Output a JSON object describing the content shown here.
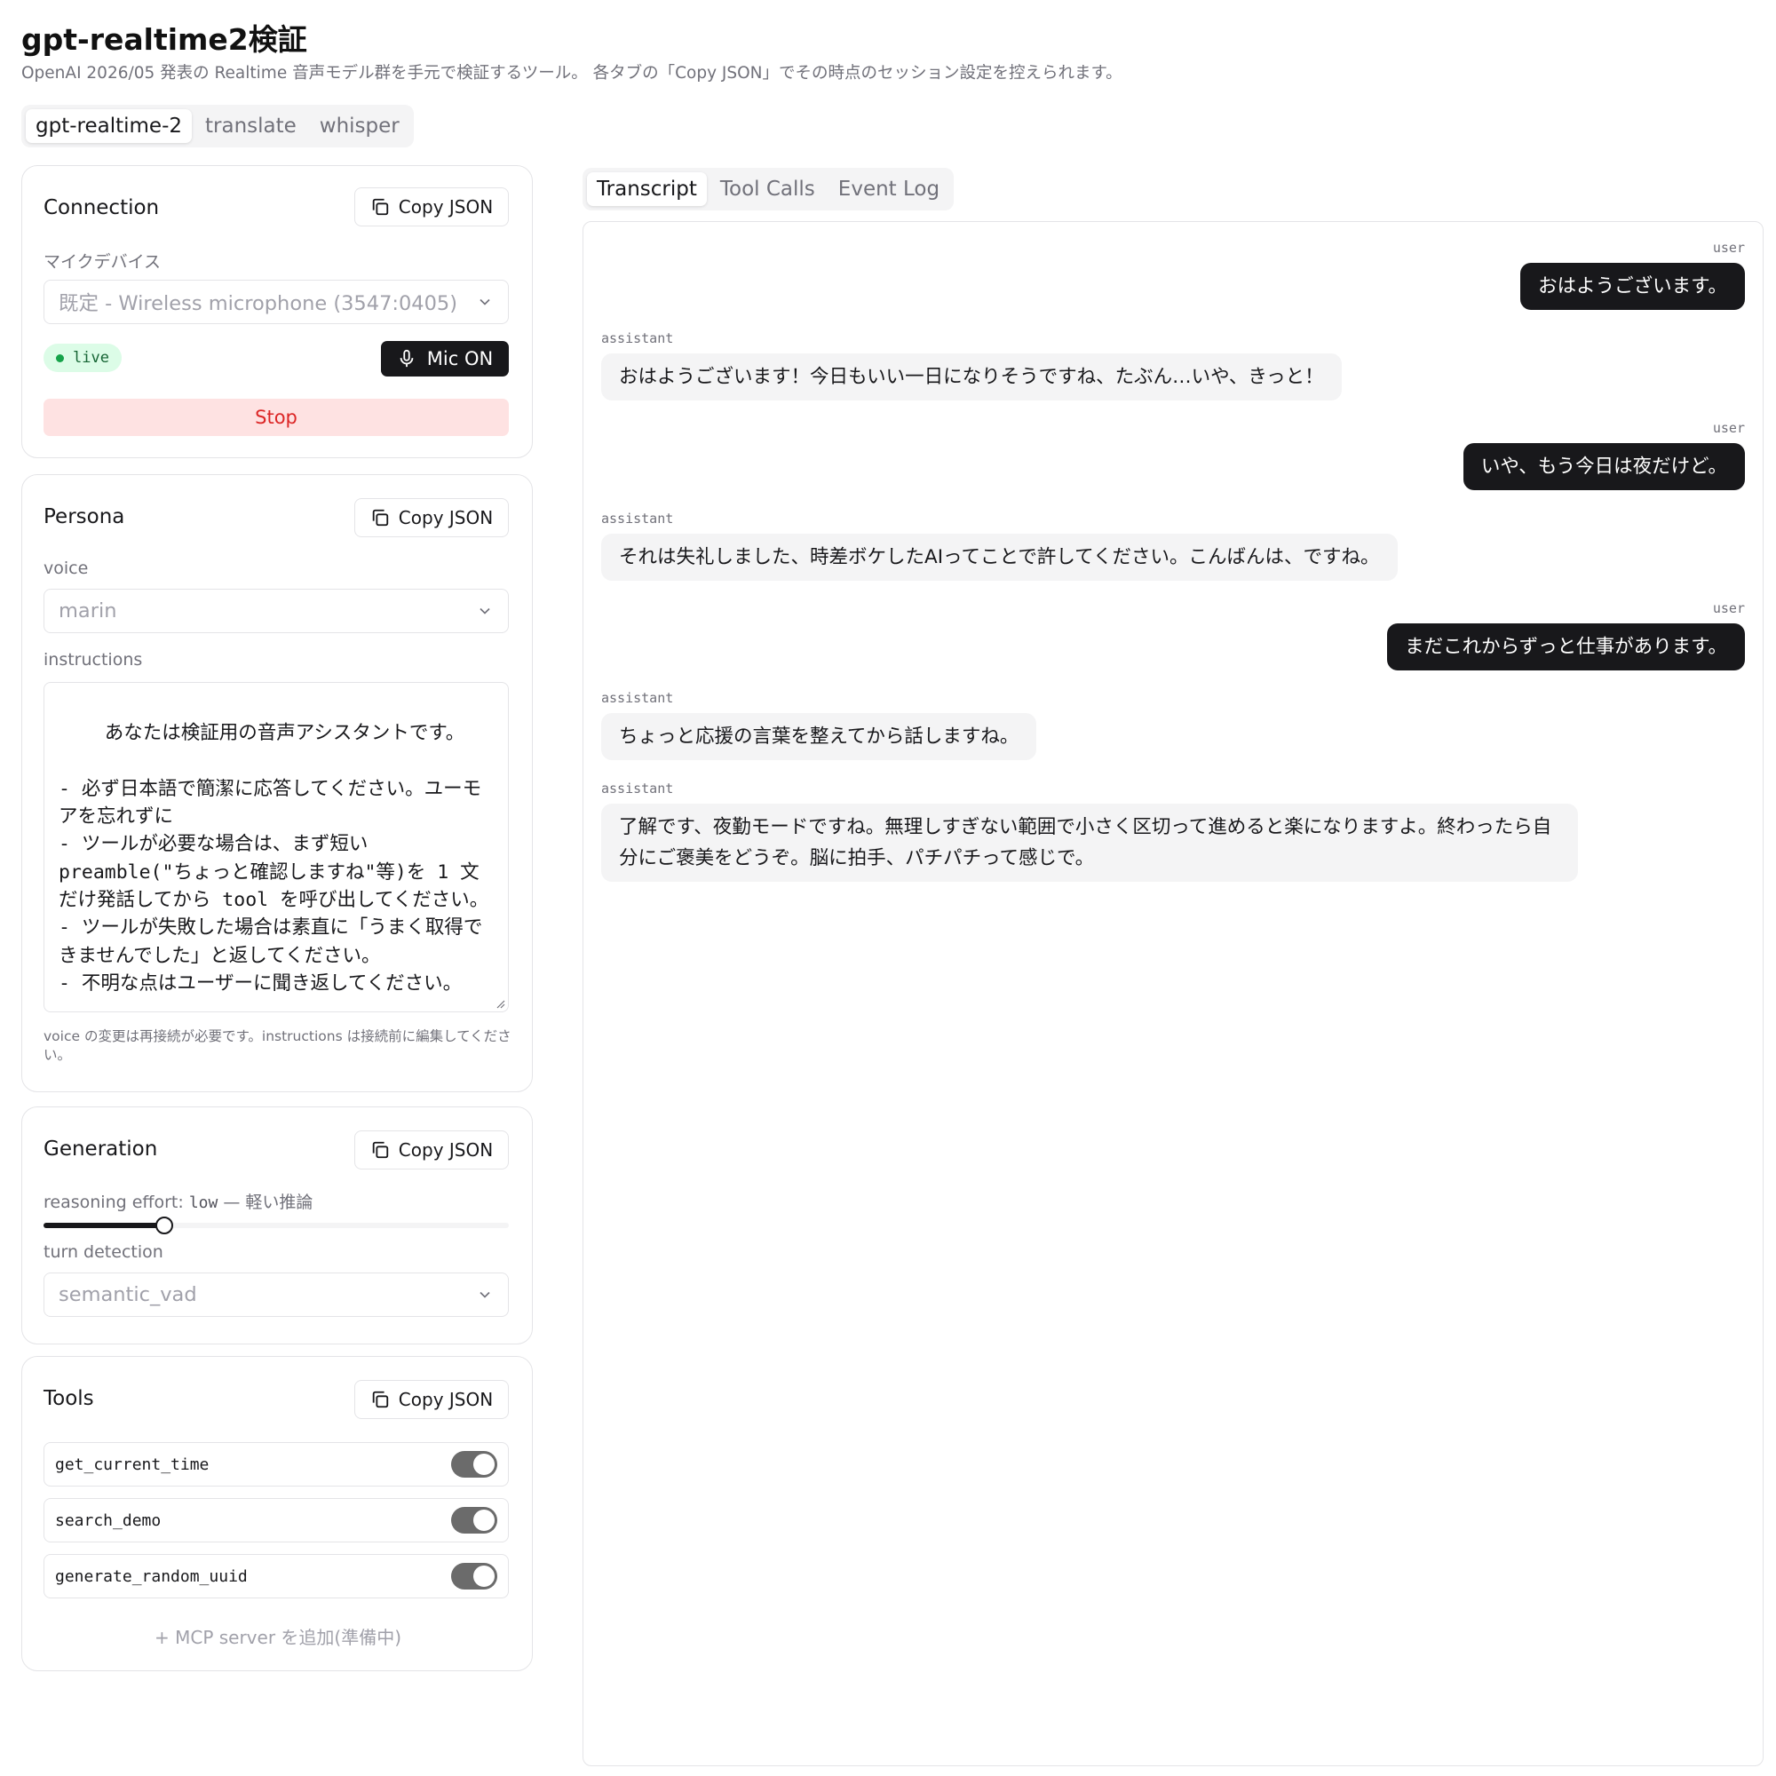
{
  "header": {
    "title": "gpt-realtime2検証",
    "subtitle": "OpenAI 2026/05 発表の Realtime 音声モデル群を手元で検証するツール。 各タブの「Copy JSON」でその時点のセッション設定を控えられます。"
  },
  "main_tabs": [
    {
      "label": "gpt-realtime-2",
      "active": true
    },
    {
      "label": "translate",
      "active": false
    },
    {
      "label": "whisper",
      "active": false
    }
  ],
  "copy_json_label": "Copy JSON",
  "connection": {
    "title": "Connection",
    "mic_device_label": "マイクデバイス",
    "mic_device_value": "既定 - Wireless microphone (3547:0405)",
    "status_badge": "live",
    "mic_button": "Mic ON",
    "stop_button": "Stop"
  },
  "persona": {
    "title": "Persona",
    "voice_label": "voice",
    "voice_value": "marin",
    "instructions_label": "instructions",
    "instructions_value": "あなたは検証用の音声アシスタントです。\n\n- 必ず日本語で簡潔に応答してください。ユーモアを忘れずに\n- ツールが必要な場合は、まず短い preamble(\"ちょっと確認しますね\"等)を 1 文だけ発話してから tool を呼び出してください。\n- ツールが失敗した場合は素直に「うまく取得できませんでした」と返してください。\n- 不明な点はユーザーに聞き返してください。",
    "help_text": "voice の変更は再接続が必要です。instructions は接続前に編集してください。"
  },
  "generation": {
    "title": "Generation",
    "reasoning_label": "reasoning effort:",
    "reasoning_value": "low",
    "reasoning_desc": "— 軽い推論",
    "reasoning_level": 0.26,
    "turn_detection_label": "turn detection",
    "turn_detection_value": "semantic_vad"
  },
  "tools": {
    "title": "Tools",
    "items": [
      {
        "name": "get_current_time",
        "enabled": true
      },
      {
        "name": "search_demo",
        "enabled": true
      },
      {
        "name": "generate_random_uuid",
        "enabled": true
      }
    ],
    "add_mcp_label": "+ MCP server を追加(準備中)"
  },
  "right_tabs": [
    {
      "label": "Transcript",
      "active": true
    },
    {
      "label": "Tool Calls",
      "active": false
    },
    {
      "label": "Event Log",
      "active": false
    }
  ],
  "transcript": [
    {
      "role": "user",
      "text": "おはようございます。"
    },
    {
      "role": "assistant",
      "text": "おはようございます！今日もいい一日になりそうですね、たぶん…いや、きっと！"
    },
    {
      "role": "user",
      "text": "いや、もう今日は夜だけど。"
    },
    {
      "role": "assistant",
      "text": "それは失礼しました、時差ボケしたAIってことで許してください。こんばんは、ですね。"
    },
    {
      "role": "user",
      "text": "まだこれからずっと仕事があります。"
    },
    {
      "role": "assistant",
      "text": "ちょっと応援の言葉を整えてから話しますね。"
    },
    {
      "role": "assistant",
      "text": "了解です、夜勤モードですね。無理しすぎない範囲で小さく区切って進めると楽になりますよ。終わったら自分にご褒美をどうぞ。脳に拍手、パチパチって感じで。"
    }
  ]
}
